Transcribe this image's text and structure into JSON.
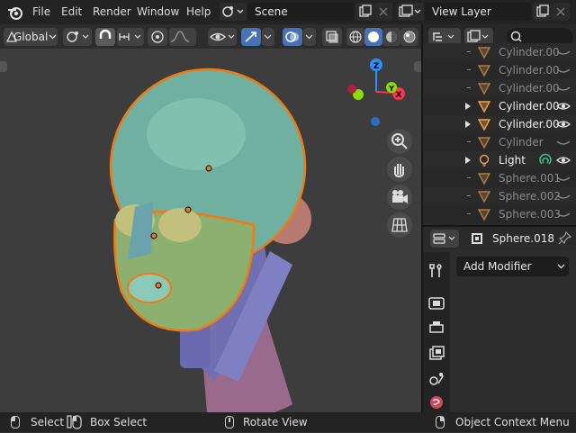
{
  "menubar": {
    "items": [
      "File",
      "Edit",
      "Render",
      "Window",
      "Help"
    ],
    "scene": "Scene",
    "view_layer": "View Layer"
  },
  "viewport_header": {
    "orientation": "Global"
  },
  "gizmo": {
    "z_label": "Z",
    "y_label": "Y",
    "x_label": "X"
  },
  "outliner": {
    "search_placeholder": "",
    "rows": [
      {
        "name": "Cylinder.00",
        "dim": true
      },
      {
        "name": "Cylinder.00",
        "dim": true
      },
      {
        "name": "Cylinder.00",
        "dim": true
      },
      {
        "name": "Cylinder.00",
        "dim": false
      },
      {
        "name": "Cylinder.00",
        "dim": false
      },
      {
        "name": "Cylinder",
        "dim": true
      },
      {
        "name": "Light",
        "dim": false
      },
      {
        "name": "Sphere.001",
        "dim": true
      },
      {
        "name": "Sphere.002",
        "dim": true
      },
      {
        "name": "Sphere.003",
        "dim": true
      }
    ]
  },
  "properties": {
    "object_name": "Sphere.018",
    "add_modifier": "Add Modifier"
  },
  "statusbar": {
    "select": "Select",
    "box_select": "Box Select",
    "rotate_view": "Rotate View",
    "context_menu": "Object Context Menu"
  },
  "colors": {
    "accent": "#4772b3",
    "selection_orange": "#f07a14",
    "x_axis": "#ff3352",
    "y_axis": "#8bdc00",
    "z_axis": "#2c8fff"
  }
}
